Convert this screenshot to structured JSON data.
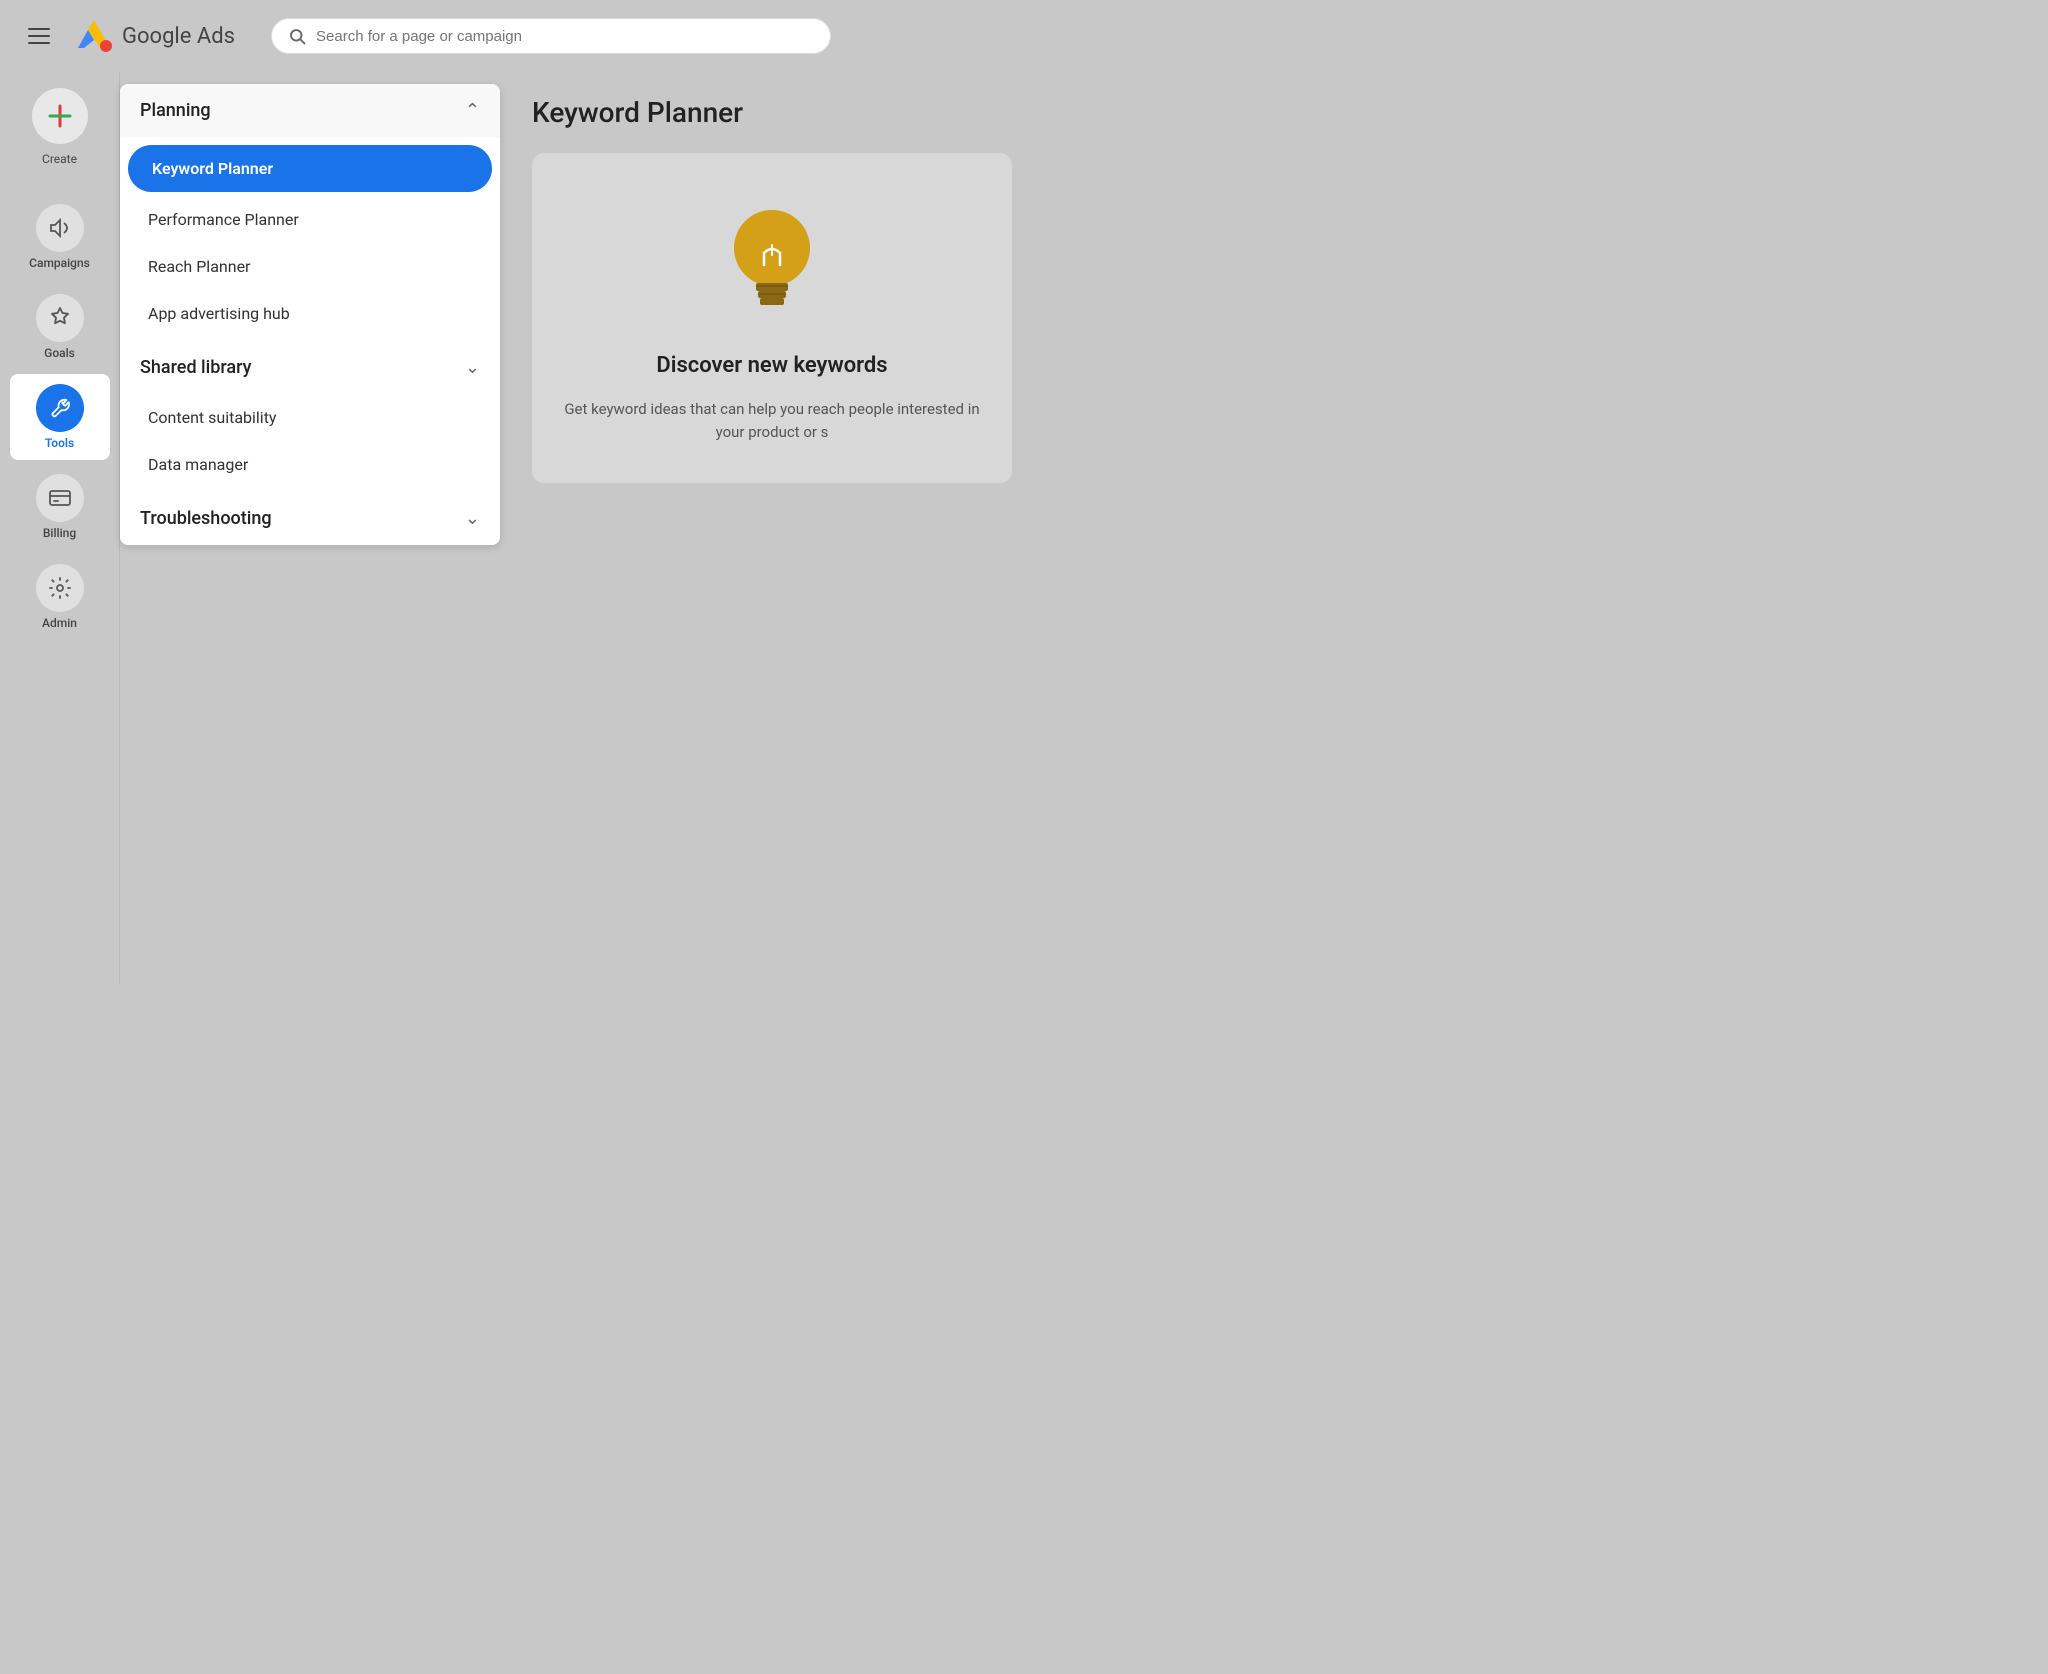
{
  "header": {
    "hamburger_label": "menu",
    "logo_alt": "Google Ads logo",
    "app_title": "Google Ads",
    "search_placeholder": "Search for a page or campaign"
  },
  "sidebar": {
    "create_label": "Create",
    "items": [
      {
        "id": "campaigns",
        "label": "Campaigns",
        "icon": "📣"
      },
      {
        "id": "goals",
        "label": "Goals",
        "icon": "🏆"
      },
      {
        "id": "tools",
        "label": "Tools",
        "icon": "🔧",
        "active": true
      },
      {
        "id": "billing",
        "label": "Billing",
        "icon": "💳"
      },
      {
        "id": "admin",
        "label": "Admin",
        "icon": "⚙️"
      }
    ]
  },
  "dropdown": {
    "planning_section": {
      "label": "Planning",
      "expanded": true
    },
    "items": [
      {
        "id": "keyword-planner",
        "label": "Keyword Planner",
        "active": true
      },
      {
        "id": "performance-planner",
        "label": "Performance Planner"
      },
      {
        "id": "reach-planner",
        "label": "Reach Planner"
      },
      {
        "id": "app-advertising-hub",
        "label": "App advertising hub"
      }
    ],
    "shared_library": {
      "label": "Shared library",
      "expanded": false
    },
    "other_items": [
      {
        "id": "content-suitability",
        "label": "Content suitability"
      },
      {
        "id": "data-manager",
        "label": "Data manager"
      }
    ],
    "troubleshooting": {
      "label": "Troubleshooting",
      "expanded": false
    }
  },
  "main": {
    "page_title": "Keyword Planner",
    "card": {
      "title": "Discover new keywords",
      "description": "Get keyword ideas that can help you reach people interested in your product or s"
    }
  }
}
